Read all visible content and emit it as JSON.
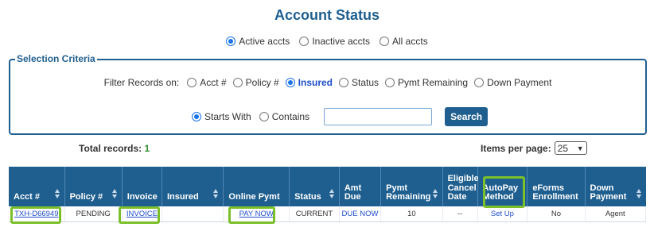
{
  "page": {
    "title": "Account Status"
  },
  "scope_options": [
    {
      "label": "Active accts",
      "checked": true
    },
    {
      "label": "Inactive accts",
      "checked": false
    },
    {
      "label": "All accts",
      "checked": false
    }
  ],
  "criteria": {
    "legend": "Selection Criteria",
    "filter_label": "Filter Records on:",
    "filter_options": [
      {
        "label": "Acct #",
        "checked": false
      },
      {
        "label": "Policy #",
        "checked": false
      },
      {
        "label": "Insured",
        "checked": true
      },
      {
        "label": "Status",
        "checked": false
      },
      {
        "label": "Pymt Remaining",
        "checked": false
      },
      {
        "label": "Down Payment",
        "checked": false
      }
    ],
    "match_options": [
      {
        "label": "Starts With",
        "checked": true
      },
      {
        "label": "Contains",
        "checked": false
      }
    ],
    "search_value": "",
    "search_button": "Search"
  },
  "summary": {
    "total_label": "Total records:",
    "total_count": "1",
    "ipp_label": "Items per page:",
    "ipp_value": "25"
  },
  "table": {
    "headers": [
      {
        "label": "Acct #",
        "sortable": true
      },
      {
        "label": "Policy #",
        "sortable": true
      },
      {
        "label": "Invoice",
        "sortable": false
      },
      {
        "label": "Insured",
        "sortable": true
      },
      {
        "label": "Online Pymt",
        "sortable": false
      },
      {
        "label": "Status",
        "sortable": true
      },
      {
        "label": "Amt Due",
        "sortable": false
      },
      {
        "label": "Pymt Remaining",
        "sortable": true
      },
      {
        "label": "Eligible Cancel Date",
        "sortable": false
      },
      {
        "label": "AutoPay Method",
        "sortable": false
      },
      {
        "label": "eForms Enrollment",
        "sortable": false
      },
      {
        "label": "Down Payment",
        "sortable": true
      }
    ],
    "rows": [
      {
        "acct": "TXH-D66949",
        "policy": "PENDING",
        "invoice": "INVOICE",
        "insured": "",
        "online_pymt": "PAY NOW",
        "status": "CURRENT",
        "amt_due": "DUE NOW",
        "pymt_remaining": "10",
        "cancel_date": "--",
        "autopay": "Set Up",
        "eforms": "No",
        "down_payment": "Agent"
      }
    ]
  },
  "colors": {
    "brand": "#1f5f8f",
    "highlight": "#7bbf2a",
    "link": "#1f4ec9",
    "count": "#2f8f2f"
  }
}
